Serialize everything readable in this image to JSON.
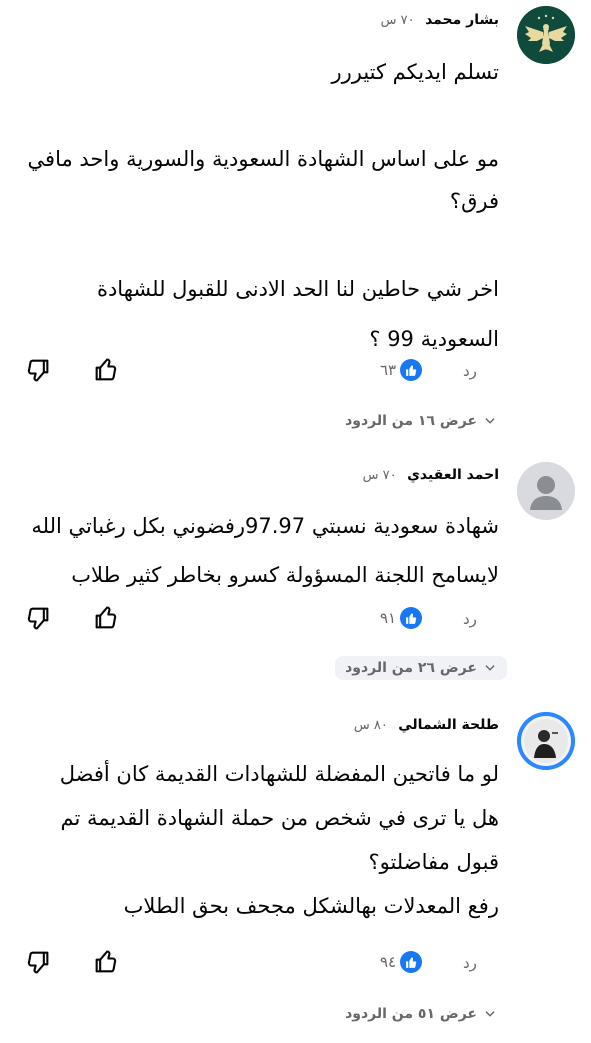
{
  "comments": [
    {
      "author": "بشار محمد",
      "time": "٧٠ س",
      "paragraphs": [
        "تسلم ايديكم كتيررر",
        "مو على اساس الشهادة السعودية والسورية واحد مافي فرق؟",
        "اخر شي حاطين لنا الحد الادنى للقبول للشهادة السعودية 99 ؟"
      ],
      "reaction_count": "٦٣",
      "reply_label": "رد",
      "view_replies": "عرض ١٦ من الردود",
      "avatar_icon": "eagle-emblem-icon"
    },
    {
      "author": "احمد العقيدي",
      "time": "٧٠ س",
      "paragraphs": [
        "شهادة سعودية نسبتي 97.97رفضوني بكل رغباتي الله لايسامح اللجنة المسؤولة كسرو بخاطر كثير طلاب"
      ],
      "reaction_count": "٩١",
      "reply_label": "رد",
      "view_replies": "عرض ٢٦ من الردود",
      "avatar_icon": "default-person-icon"
    },
    {
      "author": "طلحة الشمالي",
      "time": "٨٠ س",
      "paragraphs": [
        "لو ما فاتحين المفضلة للشهادات القديمة كان أفضل",
        "هل يا ترى في شخص من حملة الشهادة القديمة تم قبول مفاضلتو؟",
        "رفع المعدلات بهالشكل مجحف بحق الطلاب"
      ],
      "reaction_count": "٩٤",
      "reply_label": "رد",
      "view_replies": "عرض ٥١ من الردود",
      "avatar_icon": "person-photo-icon"
    }
  ],
  "colors": {
    "text": "#050505",
    "secondary": "#65676b",
    "like_blue": "#1877f2",
    "avatar1_bg": "#0f4a3c",
    "replies_bg": "#f0f2f5"
  }
}
